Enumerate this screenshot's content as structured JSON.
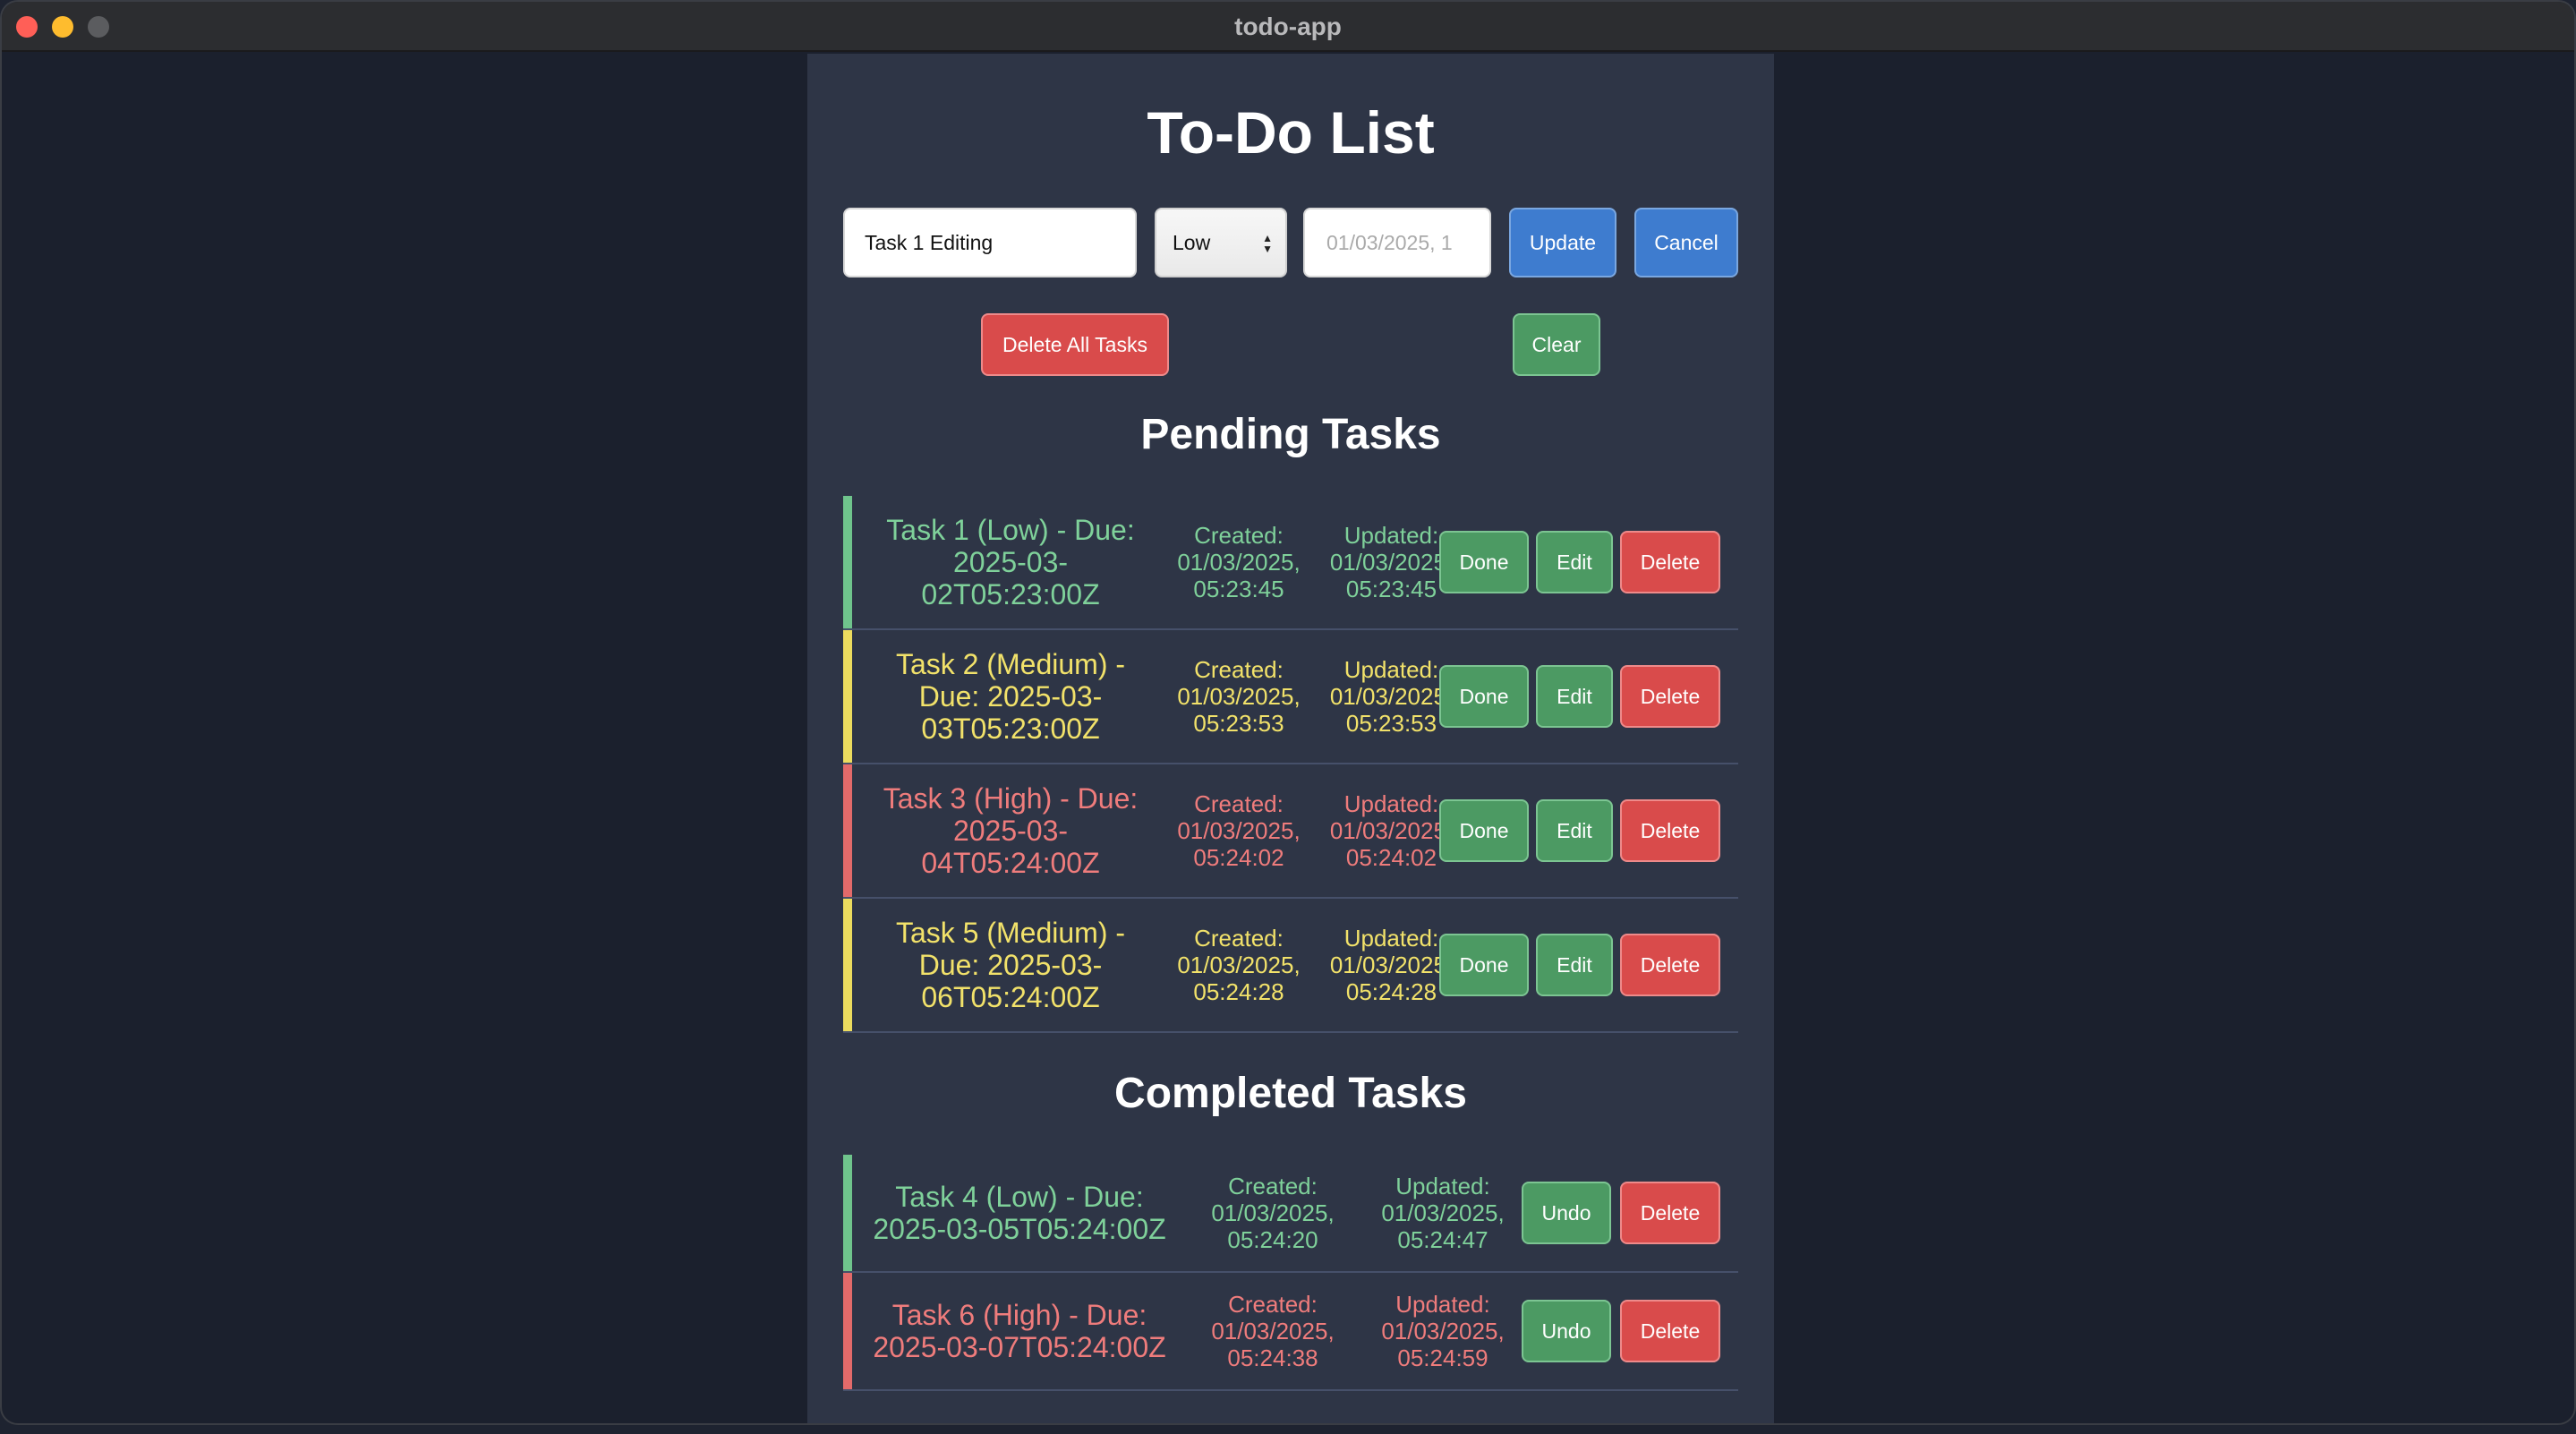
{
  "window": {
    "title": "todo-app"
  },
  "app": {
    "title": "To-Do List",
    "form": {
      "task_value": "Task 1 Editing",
      "task_placeholder": "",
      "priority_value": "Low",
      "date_value": "01/03/2025, 1",
      "update_label": "Update",
      "cancel_label": "Cancel",
      "delete_all_label": "Delete All Tasks",
      "clear_label": "Clear"
    },
    "pending": {
      "heading": "Pending Tasks",
      "tasks": [
        {
          "title_line1": "Task 1 (Low) - Due:",
          "title_line2": "2025-03-",
          "title_line3": "02T05:23:00Z",
          "priority": "low",
          "created_label": "Created:",
          "created_date": "01/03/2025,",
          "created_time": "05:23:45",
          "updated_label": "Updated:",
          "updated_date": "01/03/2025,",
          "updated_time": "05:23:45",
          "done": "Done",
          "edit": "Edit",
          "delete": "Delete"
        },
        {
          "title_line1": "Task 2 (Medium) -",
          "title_line2": "Due: 2025-03-",
          "title_line3": "03T05:23:00Z",
          "priority": "medium",
          "created_label": "Created:",
          "created_date": "01/03/2025,",
          "created_time": "05:23:53",
          "updated_label": "Updated:",
          "updated_date": "01/03/2025,",
          "updated_time": "05:23:53",
          "done": "Done",
          "edit": "Edit",
          "delete": "Delete"
        },
        {
          "title_line1": "Task 3 (High) - Due:",
          "title_line2": "2025-03-",
          "title_line3": "04T05:24:00Z",
          "priority": "high",
          "created_label": "Created:",
          "created_date": "01/03/2025,",
          "created_time": "05:24:02",
          "updated_label": "Updated:",
          "updated_date": "01/03/2025,",
          "updated_time": "05:24:02",
          "done": "Done",
          "edit": "Edit",
          "delete": "Delete"
        },
        {
          "title_line1": "Task 5 (Medium) -",
          "title_line2": "Due: 2025-03-",
          "title_line3": "06T05:24:00Z",
          "priority": "medium",
          "created_label": "Created:",
          "created_date": "01/03/2025,",
          "created_time": "05:24:28",
          "updated_label": "Updated:",
          "updated_date": "01/03/2025,",
          "updated_time": "05:24:28",
          "done": "Done",
          "edit": "Edit",
          "delete": "Delete"
        }
      ]
    },
    "completed": {
      "heading": "Completed Tasks",
      "tasks": [
        {
          "title_line1": "Task 4 (Low) - Due:",
          "title_line2": "2025-03-05T05:24:00Z",
          "priority": "low",
          "created_label": "Created:",
          "created_date": "01/03/2025,",
          "created_time": "05:24:20",
          "updated_label": "Updated:",
          "updated_date": "01/03/2025,",
          "updated_time": "05:24:47",
          "undo": "Undo",
          "delete": "Delete"
        },
        {
          "title_line1": "Task 6 (High) - Due:",
          "title_line2": "2025-03-07T05:24:00Z",
          "priority": "high",
          "created_label": "Created:",
          "created_date": "01/03/2025,",
          "created_time": "05:24:38",
          "updated_label": "Updated:",
          "updated_date": "01/03/2025,",
          "updated_time": "05:24:59",
          "undo": "Undo",
          "delete": "Delete"
        }
      ]
    }
  },
  "colors": {
    "low": "#7fd19a",
    "medium": "#f2e26a",
    "high": "#ef7c7c",
    "done_button": "#4c9a63",
    "delete_button": "#d94b4b",
    "update_button": "#3e7ccf"
  }
}
